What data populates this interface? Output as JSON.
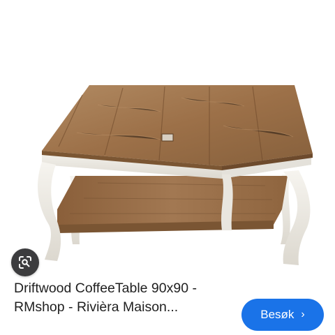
{
  "product": {
    "image_alt": "Driftwood coffee table with white legs",
    "title_line1": "Driftwood CoffeeTable 90x90 -",
    "title_line2": "RMshop - Rivièra Maison..."
  },
  "visit_button": {
    "label": "Besøk",
    "chevron": "›"
  },
  "lens_button": {
    "icon": "lens-search-icon"
  },
  "colors": {
    "accent": "#1a73e8",
    "wood": "#9c7048",
    "paint": "#f1efe9",
    "lens_bg": "#3c3c3e"
  }
}
